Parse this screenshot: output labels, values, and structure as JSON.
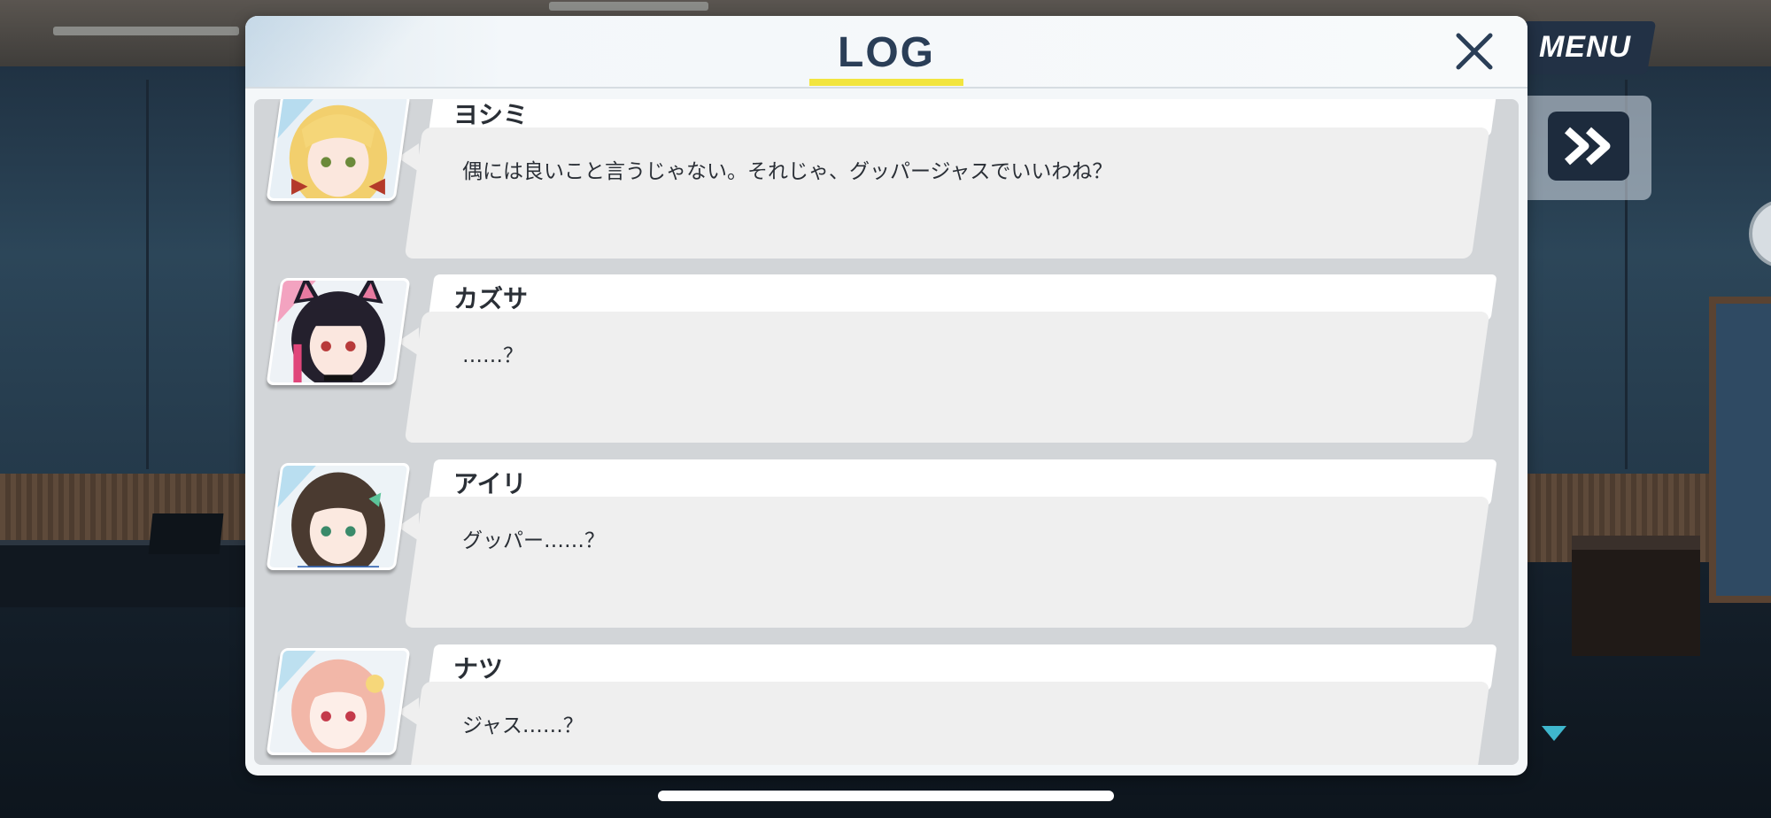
{
  "modal": {
    "title": "LOG",
    "close_icon": "close-x-icon"
  },
  "hud": {
    "menu_label": "MENU",
    "fast_forward_icon": "fast-forward-icon",
    "scroll_down_icon": "scroll-down-triangle-icon"
  },
  "log": {
    "entries": [
      {
        "speaker": "ヨシミ",
        "text": "偶には良いこと言うじゃない。それじゃ、グッパージャスでいいわね？",
        "avatar": "yoshimi-avatar"
      },
      {
        "speaker": "カズサ",
        "text": "……？",
        "avatar": "kazusa-avatar"
      },
      {
        "speaker": "アイリ",
        "text": "グッパー……？",
        "avatar": "airi-avatar"
      },
      {
        "speaker": "ナツ",
        "text": "ジャス……？",
        "avatar": "natsu-avatar"
      }
    ]
  },
  "colors": {
    "title": "#2a3e57",
    "title_underline": "#f2e53f",
    "bubble": "#efefef",
    "log_background": "#d2d5d8",
    "scroll_arrow": "#3fb7cd"
  }
}
